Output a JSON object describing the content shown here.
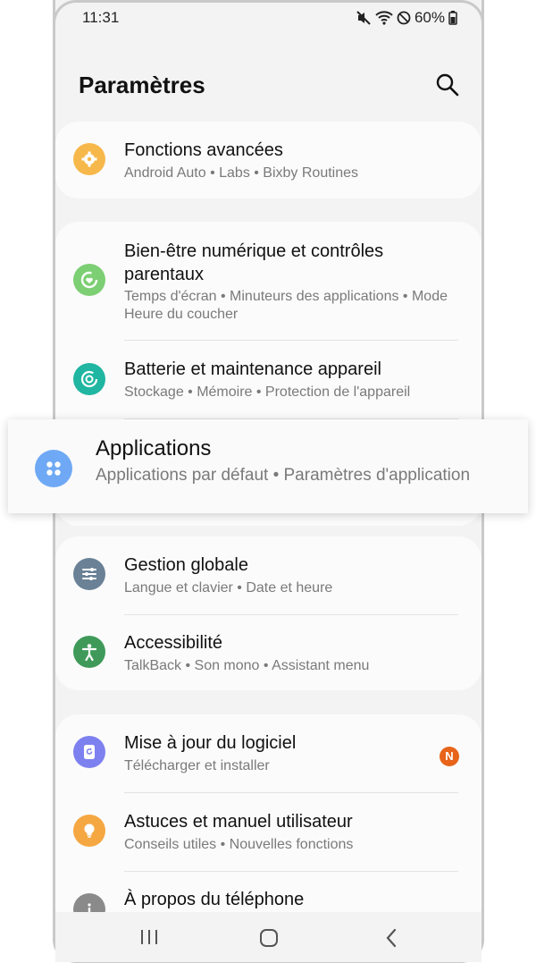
{
  "status_bar": {
    "time": "11:31",
    "battery": "60%"
  },
  "header": {
    "title": "Paramètres"
  },
  "colors": {
    "advanced": "#f7b84b",
    "wellbeing": "#7ccf73",
    "battery": "#20b6a1",
    "apps": "#6fa9f5",
    "general": "#6a8196",
    "accessibility": "#3f9a5a",
    "update": "#7d80ef",
    "tips": "#f5a742",
    "about": "#8a8a8a",
    "badge": "#e7641a"
  },
  "items": {
    "advanced": {
      "title": "Fonctions avancées",
      "subtitle": "Android Auto  •  Labs  •  Bixby Routines",
      "icon": "puzzle-gear-icon"
    },
    "wellbeing": {
      "title": "Bien-être numérique et contrôles parentaux",
      "subtitle": "Temps d'écran  •  Minuteurs des applications  •  Mode Heure du coucher",
      "icon": "wellbeing-icon"
    },
    "battery": {
      "title": "Batterie et maintenance appareil",
      "subtitle": "Stockage  •  Mémoire  •  Protection de l'appareil",
      "icon": "device-care-icon"
    },
    "apps": {
      "title": "Applications",
      "subtitle": "Applications par défaut  •  Paramètres d'application",
      "icon": "apps-grid-icon"
    },
    "general": {
      "title": "Gestion globale",
      "subtitle": "Langue et clavier  •  Date et heure",
      "icon": "sliders-icon"
    },
    "accessibility": {
      "title": "Accessibilité",
      "subtitle": "TalkBack  •  Son mono  •  Assistant menu",
      "icon": "accessibility-icon"
    },
    "update": {
      "title": "Mise à jour du logiciel",
      "subtitle": "Télécharger et installer",
      "icon": "software-update-icon",
      "badge": "N"
    },
    "tips": {
      "title": "Astuces et manuel utilisateur",
      "subtitle": "Conseils utiles  •  Nouvelles fonctions",
      "icon": "lightbulb-icon"
    },
    "about": {
      "title": "À propos du téléphone",
      "icon": "info-icon"
    }
  },
  "navbar": {
    "recents": "recents-icon",
    "home": "home-icon",
    "back": "back-icon"
  }
}
